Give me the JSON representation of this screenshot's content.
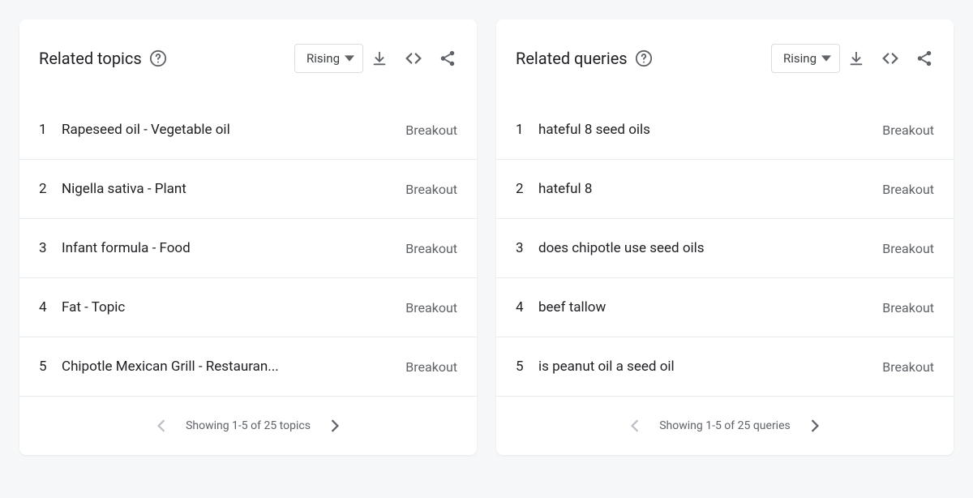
{
  "left": {
    "title": "Related topics",
    "dropdown": "Rising",
    "items": [
      {
        "rank": "1",
        "label": "Rapeseed oil - Vegetable oil",
        "value": "Breakout"
      },
      {
        "rank": "2",
        "label": "Nigella sativa - Plant",
        "value": "Breakout"
      },
      {
        "rank": "3",
        "label": "Infant formula - Food",
        "value": "Breakout"
      },
      {
        "rank": "4",
        "label": "Fat - Topic",
        "value": "Breakout"
      },
      {
        "rank": "5",
        "label": "Chipotle Mexican Grill - Restauran...",
        "value": "Breakout"
      }
    ],
    "pager": "Showing 1-5 of 25 topics"
  },
  "right": {
    "title": "Related queries",
    "dropdown": "Rising",
    "items": [
      {
        "rank": "1",
        "label": "hateful 8 seed oils",
        "value": "Breakout"
      },
      {
        "rank": "2",
        "label": "hateful 8",
        "value": "Breakout"
      },
      {
        "rank": "3",
        "label": "does chipotle use seed oils",
        "value": "Breakout"
      },
      {
        "rank": "4",
        "label": "beef tallow",
        "value": "Breakout"
      },
      {
        "rank": "5",
        "label": "is peanut oil a seed oil",
        "value": "Breakout"
      }
    ],
    "pager": "Showing 1-5 of 25 queries"
  }
}
